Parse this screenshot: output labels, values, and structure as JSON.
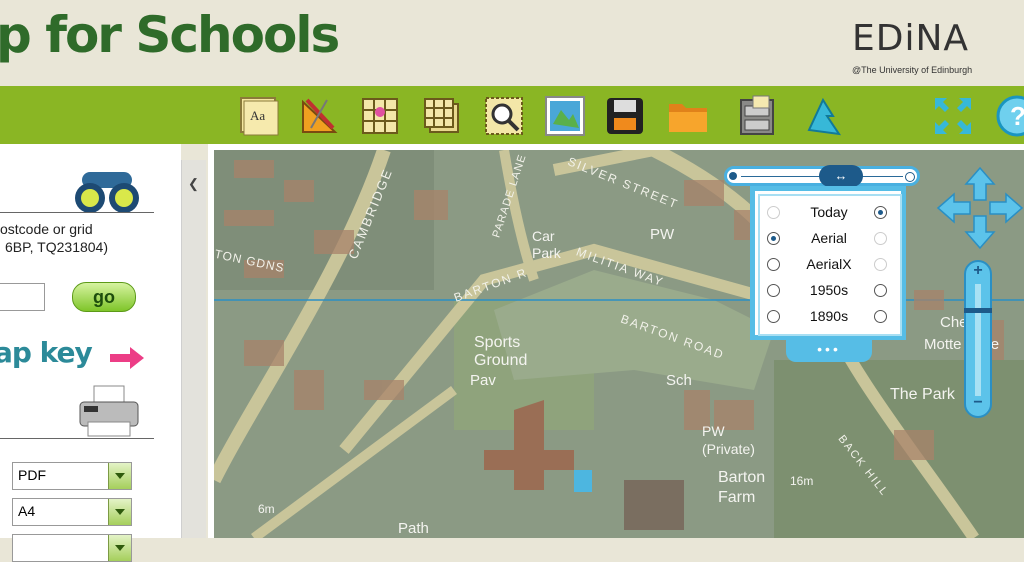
{
  "header": {
    "title": "p for Schools",
    "logo_text": "EDiNA",
    "logo_subtitle": "@The University of Edinburgh"
  },
  "toolbar": {
    "items": [
      {
        "icon": "annotation-text-icon",
        "label": "Aa"
      },
      {
        "icon": "measure-ruler-icon"
      },
      {
        "icon": "grid-marker-icon"
      },
      {
        "icon": "layers-grid-icon"
      },
      {
        "icon": "search-map-icon"
      },
      {
        "icon": "map-image-icon"
      },
      {
        "icon": "save-icon"
      },
      {
        "icon": "open-folder-icon"
      },
      {
        "icon": "file-cabinet-icon"
      },
      {
        "icon": "help-wizard-icon"
      },
      {
        "icon": "fullscreen-icon"
      },
      {
        "icon": "help-icon",
        "label": "?"
      }
    ]
  },
  "sidebar": {
    "search_line1": "ostcode or grid",
    "search_line2": "6BP, TQ231804)",
    "search_input_value": "",
    "go_label": "go",
    "map_key_label": "ap key",
    "print_format": "PDF",
    "paper_size": "A4"
  },
  "map": {
    "labels": [
      "CAMBRIDGE",
      "SILVER STREET",
      "PARADE LANE",
      "Car Park",
      "PW",
      "MILITIA WAY",
      "TON GDNS",
      "BARTON R",
      "BARTON ROAD",
      "Sports Ground",
      "Pav",
      "Sch",
      "PW (Private)",
      "Barton Farm",
      "16m",
      "6m",
      "Path",
      "Che Hill",
      "Motte Baile",
      "The Park",
      "BACK HILL"
    ]
  },
  "layers": {
    "options": [
      {
        "label": "Today",
        "left": false,
        "right": true
      },
      {
        "label": "Aerial",
        "left": true,
        "right": false
      },
      {
        "label": "AerialX",
        "left": false,
        "right": false
      },
      {
        "label": "1950s",
        "left": false,
        "right": false
      },
      {
        "label": "1890s",
        "left": false,
        "right": false
      }
    ],
    "more_label": "•••"
  },
  "colors": {
    "brand_green": "#8ab624",
    "title_green": "#2f6b2a",
    "control_blue": "#56bde6"
  }
}
